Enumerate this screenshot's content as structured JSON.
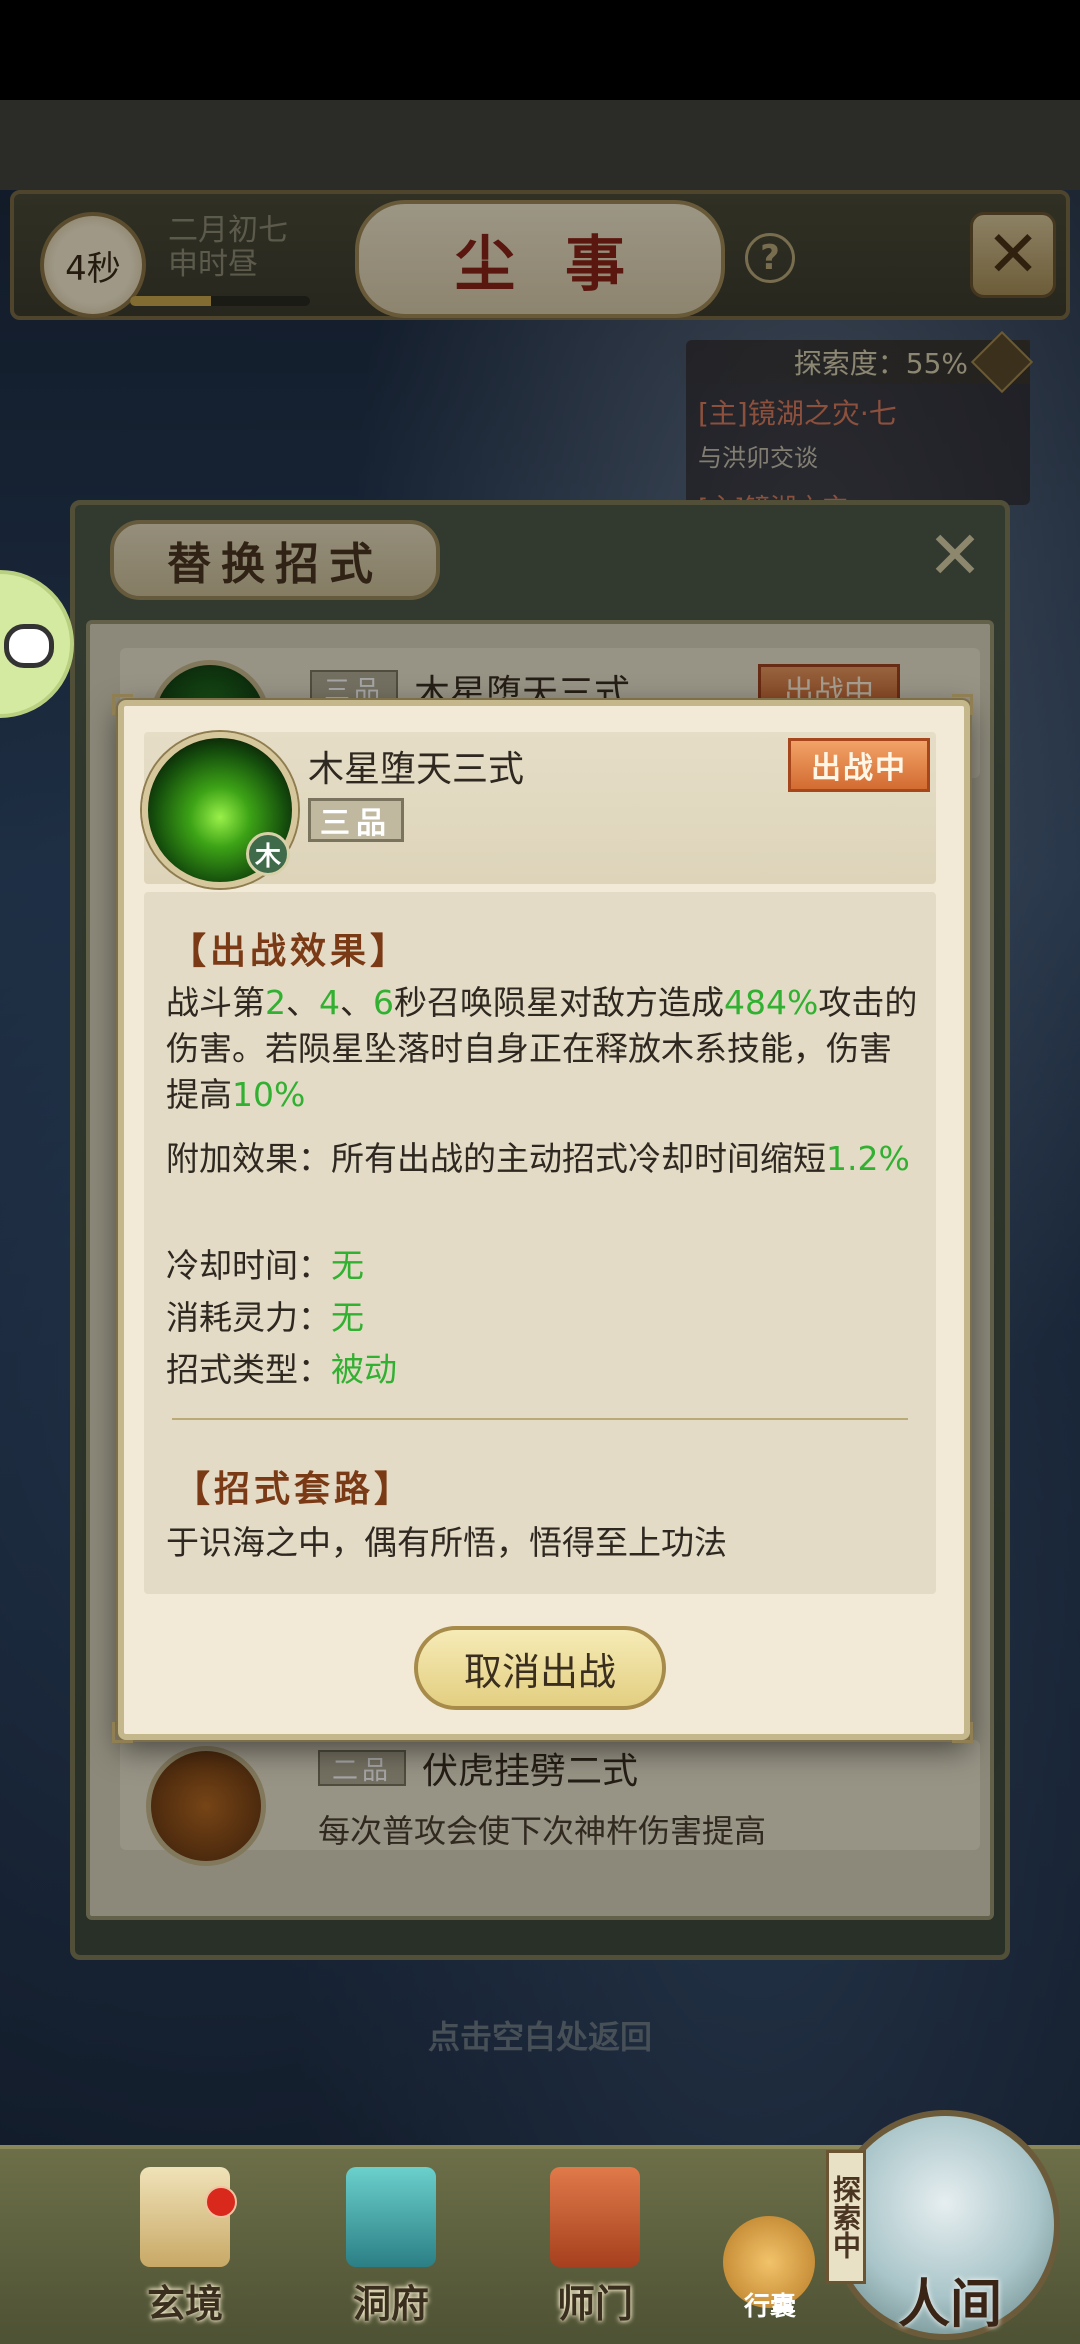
{
  "header": {
    "timer": "4秒",
    "date_line1": "二月初七",
    "date_line2": "申时昼",
    "time_progress": 0.45,
    "title": "尘事",
    "help_label": "?"
  },
  "quest": {
    "explore_label": "探索度：55%",
    "title": "[主]镜湖之灾·七",
    "subtitle": "与洪卯交谈",
    "next_partial": "[主]镜湖之灾"
  },
  "replace_panel": {
    "title": "替换招式",
    "rows": [
      {
        "tier": "三品",
        "name": "木星堕天三式",
        "badge": "出战中"
      },
      {
        "tier": "二品",
        "name": "伏虎挂劈二式",
        "desc": "每次普攻会使下次神杵伤害提高"
      }
    ],
    "back_hint": "点击空白处返回"
  },
  "detail": {
    "name": "木星堕天三式",
    "tier": "三品",
    "element": "木",
    "status_badge": "出战中",
    "effect_title": "【出战效果】",
    "effect": {
      "p1": "战斗第",
      "n1": "2",
      "sep1": "、",
      "n2": "4",
      "sep2": "、",
      "n3": "6",
      "p2": "秒召唤陨星对敌方造成",
      "pct": "484%",
      "p3": "攻击的伤害。若陨星坠落时自身正在释放木系技能，伤害提高",
      "pct2": "10%"
    },
    "extra_label": "附加效果：所有出战的主动招式冷却时间缩短",
    "extra_value": "1.2%",
    "cooldown_label": "冷却时间：",
    "cooldown_value": "无",
    "mana_label": "消耗灵力：",
    "mana_value": "无",
    "type_label": "招式类型：",
    "type_value": "被动",
    "routine_title": "【招式套路】",
    "routine_text": "于识海之中，偶有所悟，悟得至上功法",
    "cancel_button": "取消出战"
  },
  "bottom_nav": {
    "items": [
      {
        "label": "玄境"
      },
      {
        "label": "洞府"
      },
      {
        "label": "师门"
      }
    ],
    "bag_label": "行囊",
    "explore_tag": "探索中",
    "human_label": "人间"
  },
  "colors": {
    "accent_green": "#32b032",
    "badge_orange": "#d26b32",
    "title_red": "#8a2418"
  }
}
